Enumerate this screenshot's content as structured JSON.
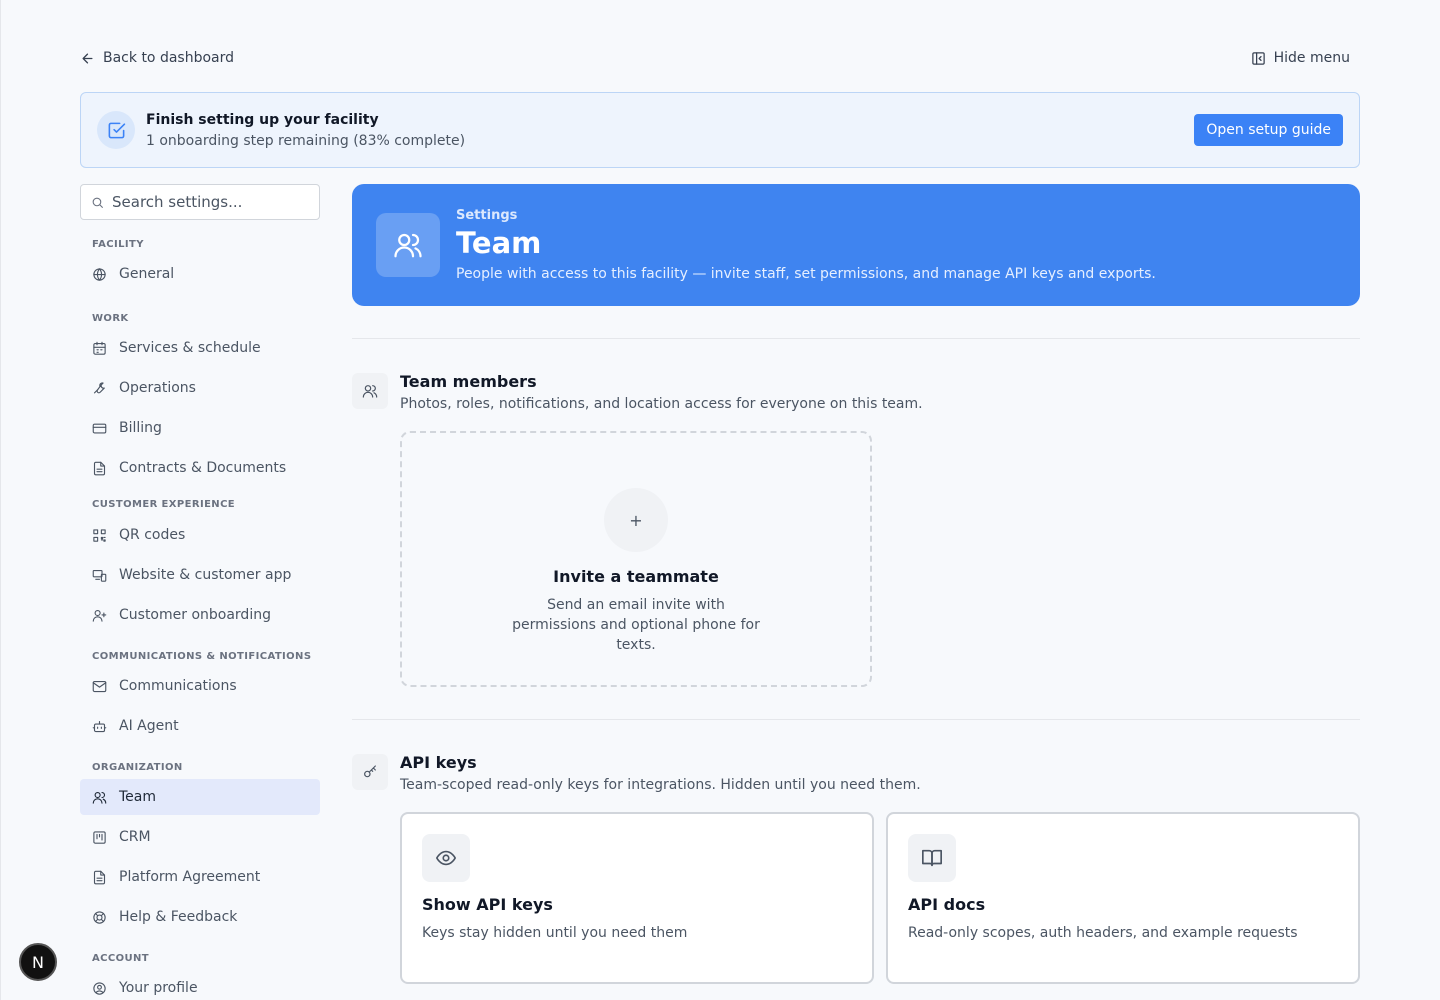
{
  "topbar": {
    "back_label": "Back to dashboard",
    "hide_menu_label": "Hide menu"
  },
  "banner": {
    "title": "Finish setting up your facility",
    "subtitle": "1 onboarding step remaining (83% complete)",
    "progress_percent": 83,
    "button_label": "Open setup guide"
  },
  "search": {
    "placeholder": "Search settings..."
  },
  "sidebar": {
    "sections": [
      {
        "label": "FACILITY",
        "items": [
          {
            "label": "General",
            "icon": "globe-icon"
          }
        ]
      },
      {
        "label": "WORK",
        "items": [
          {
            "label": "Services & schedule",
            "icon": "calendar-icon"
          },
          {
            "label": "Operations",
            "icon": "wrench-icon"
          },
          {
            "label": "Billing",
            "icon": "credit-card-icon"
          },
          {
            "label": "Contracts & Documents",
            "icon": "document-icon"
          }
        ]
      },
      {
        "label": "CUSTOMER EXPERIENCE",
        "items": [
          {
            "label": "QR codes",
            "icon": "qr-code-icon"
          },
          {
            "label": "Website & customer app",
            "icon": "devices-icon"
          },
          {
            "label": "Customer onboarding",
            "icon": "user-plus-icon"
          }
        ]
      },
      {
        "label": "COMMUNICATIONS & NOTIFICATIONS",
        "items": [
          {
            "label": "Communications",
            "icon": "mail-icon"
          },
          {
            "label": "AI Agent",
            "icon": "bot-icon"
          }
        ]
      },
      {
        "label": "ORGANIZATION",
        "items": [
          {
            "label": "Team",
            "icon": "users-icon",
            "active": true
          },
          {
            "label": "CRM",
            "icon": "kanban-icon"
          },
          {
            "label": "Platform Agreement",
            "icon": "document-icon"
          },
          {
            "label": "Help & Feedback",
            "icon": "lifebuoy-icon"
          }
        ]
      },
      {
        "label": "ACCOUNT",
        "items": [
          {
            "label": "Your profile",
            "icon": "user-circle-icon"
          }
        ]
      }
    ]
  },
  "hero": {
    "eyebrow": "Settings",
    "title": "Team",
    "subtitle": "People with access to this facility — invite staff, set permissions, and manage API keys and exports."
  },
  "team_members": {
    "title": "Team members",
    "description": "Photos, roles, notifications, and location access for everyone on this team.",
    "invite": {
      "plus": "+",
      "title": "Invite a teammate",
      "description": "Send an email invite with permissions and optional phone for texts."
    }
  },
  "api_keys": {
    "title": "API keys",
    "description": "Team-scoped read-only keys for integrations. Hidden until you need them.",
    "cards": [
      {
        "title": "Show API keys",
        "description": "Keys stay hidden until you need them",
        "icon": "eye-icon"
      },
      {
        "title": "API docs",
        "description": "Read-only scopes, auth headers, and example requests",
        "icon": "book-icon"
      }
    ]
  },
  "dev_badge": {
    "letter": "N"
  },
  "colors": {
    "accent": "#3b82f6",
    "hero_bg": "#3f84f0",
    "active_nav_bg": "#e3e9fb",
    "banner_bg": "#eef4fd"
  }
}
